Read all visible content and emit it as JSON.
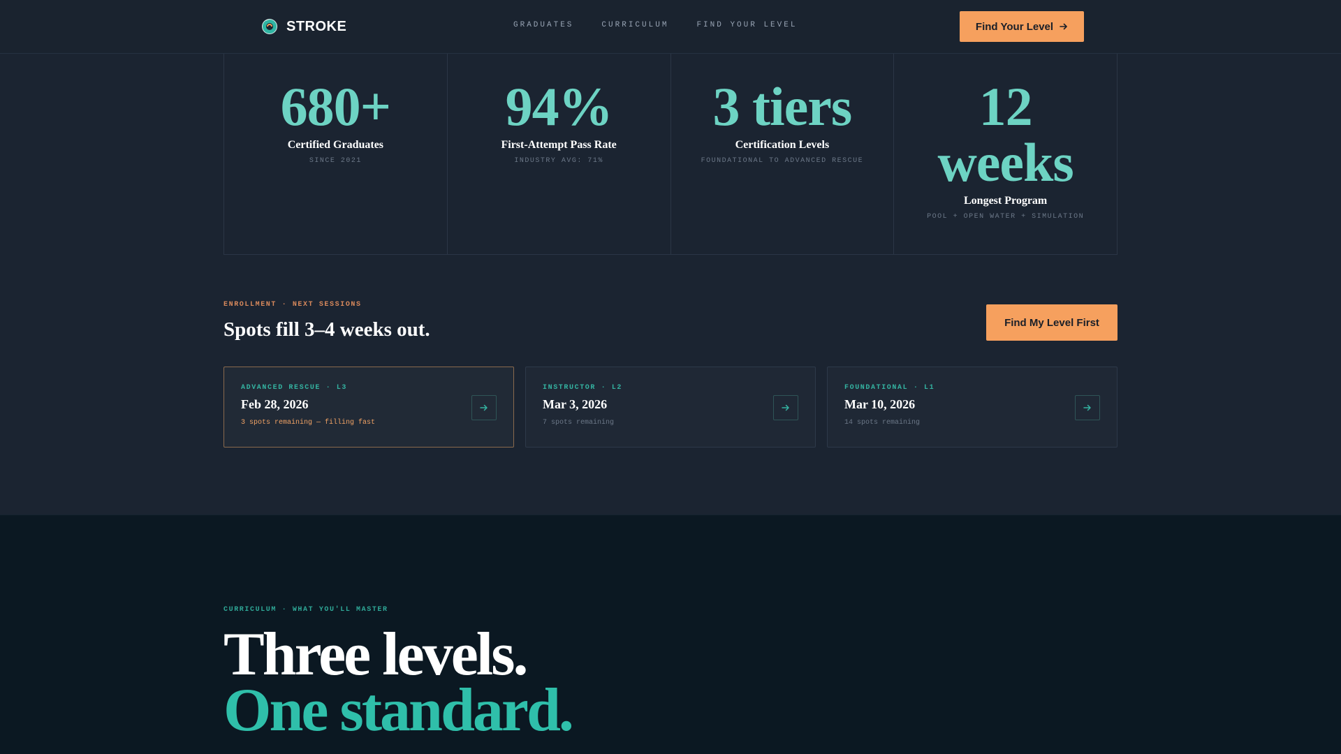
{
  "header": {
    "brand": "STROKE",
    "nav": [
      "GRADUATES",
      "CURRICULUM",
      "FIND YOUR LEVEL"
    ],
    "cta": "Find Your Level"
  },
  "stats": [
    {
      "value": "680+",
      "label": "Certified Graduates",
      "sub": "SINCE 2021"
    },
    {
      "value": "94%",
      "label": "First-Attempt Pass Rate",
      "sub": "INDUSTRY AVG: 71%"
    },
    {
      "value": "3 tiers",
      "label": "Certification Levels",
      "sub": "FOUNDATIONAL TO ADVANCED RESCUE"
    },
    {
      "value": "12 weeks",
      "label": "Longest Program",
      "sub": "POOL + OPEN WATER + SIMULATION"
    }
  ],
  "enrollment": {
    "eyebrow": "ENROLLMENT · NEXT SESSIONS",
    "title": "Spots fill 3–4 weeks out.",
    "cta": "Find My Level First",
    "sessions": [
      {
        "tag": "ADVANCED RESCUE · L3",
        "date": "Feb 28, 2026",
        "spots": "3 spots remaining — filling fast"
      },
      {
        "tag": "INSTRUCTOR · L2",
        "date": "Mar 3, 2026",
        "spots": "7 spots remaining"
      },
      {
        "tag": "FOUNDATIONAL · L1",
        "date": "Mar 10, 2026",
        "spots": "14 spots remaining"
      }
    ]
  },
  "curriculum": {
    "eyebrow": "CURRICULUM · WHAT YOU'LL MASTER",
    "headline_line1": "Three levels.",
    "headline_line2": "One standard."
  },
  "colors": {
    "accent_teal": "#6dd3c3",
    "accent_orange": "#f6a05e",
    "background": "#1b2431",
    "curriculum_background": "#0b1822"
  }
}
